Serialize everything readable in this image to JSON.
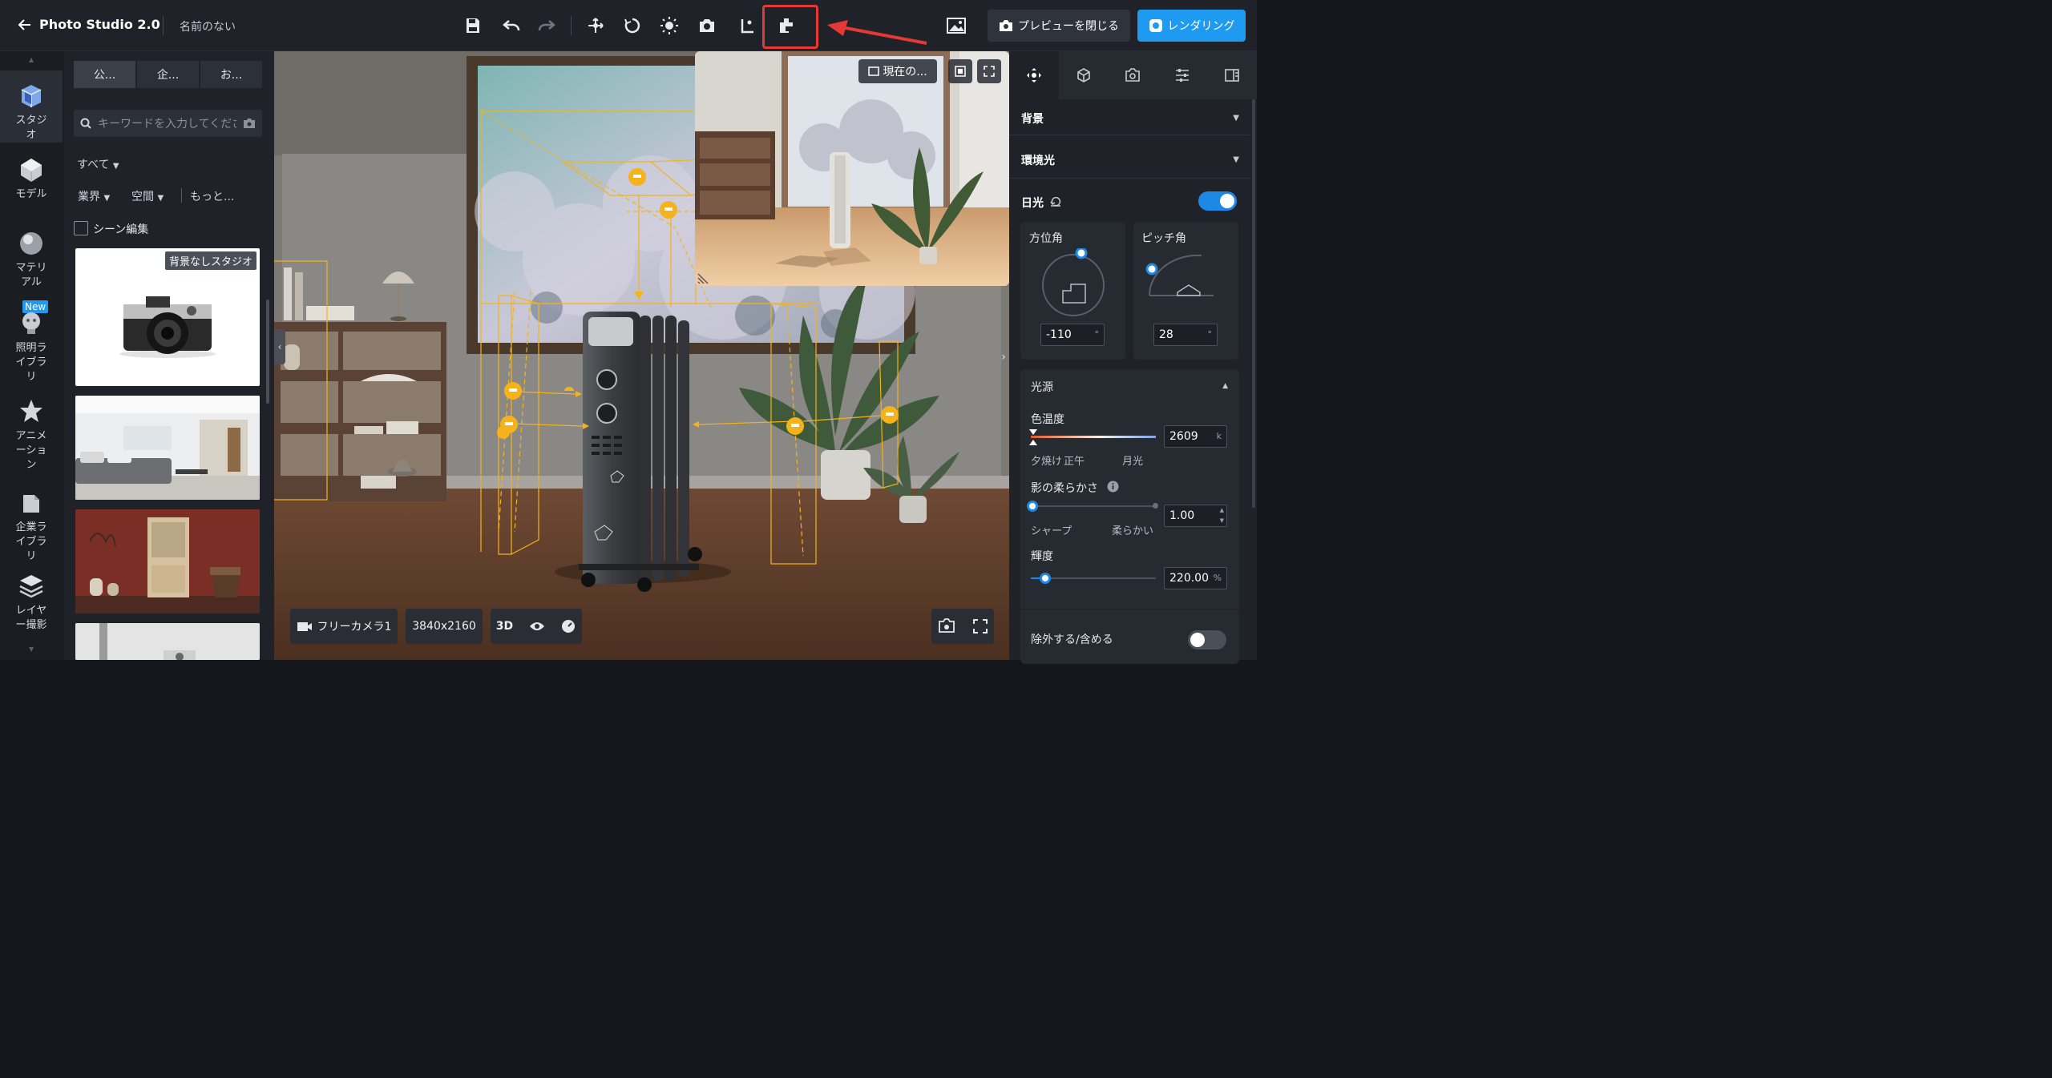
{
  "topbar": {
    "app_title": "Photo Studio 2.0",
    "doc_name": "名前のない",
    "close_preview_label": "プレビューを閉じる",
    "render_label": "レンダリング",
    "accent": "#1e9bf0",
    "highlight_color": "#e53935"
  },
  "rail": {
    "items": [
      {
        "label": "スタジオ",
        "icon": "studio-icon"
      },
      {
        "label": "モデル",
        "icon": "model-icon"
      },
      {
        "label": "マテリアル",
        "icon": "material-icon"
      },
      {
        "label": "照明ライブラリ",
        "icon": "lighting-icon",
        "badge": "New"
      },
      {
        "label": "アニメーション",
        "icon": "animation-icon"
      },
      {
        "label": "企業ライブラリ",
        "icon": "enterprise-library-icon"
      },
      {
        "label": "レイヤー撮影",
        "icon": "layer-icon"
      }
    ]
  },
  "library": {
    "tabs": [
      "公...",
      "企...",
      "お..."
    ],
    "search_placeholder": "キーワードを入力してください",
    "filter_all": "すべて",
    "filter_industry": "業界",
    "filter_space": "空間",
    "filter_more": "もっと...",
    "scene_edit": "シーン編集",
    "first_thumb_badge": "背景なしスタジオ"
  },
  "viewport": {
    "camera_label": "フリーカメラ1",
    "resolution": "3840x2160",
    "mode": "3D",
    "preview_current": "現在の..."
  },
  "right_panel": {
    "background": "背景",
    "ambient": "環境光",
    "sunlight": "日光",
    "sunlight_on": true,
    "azimuth_label": "方位角",
    "azimuth_value": "-110",
    "pitch_label": "ピッチ角",
    "pitch_value": "28",
    "deg_unit": "°",
    "light_source": "光源",
    "color_temp_label": "色温度",
    "color_temp_value": "2609",
    "color_temp_unit": "k",
    "sunset_label": "夕焼け",
    "noon_label": "正午",
    "moon_label": "月光",
    "shadow_softness_label": "影の柔らかさ",
    "shadow_value": "1.00",
    "sharp_label": "シャープ",
    "soft_label": "柔らかい",
    "brightness_label": "輝度",
    "brightness_value": "220.00",
    "brightness_unit": "%",
    "exclude_label": "除外する/含める",
    "exclude_on": false
  }
}
